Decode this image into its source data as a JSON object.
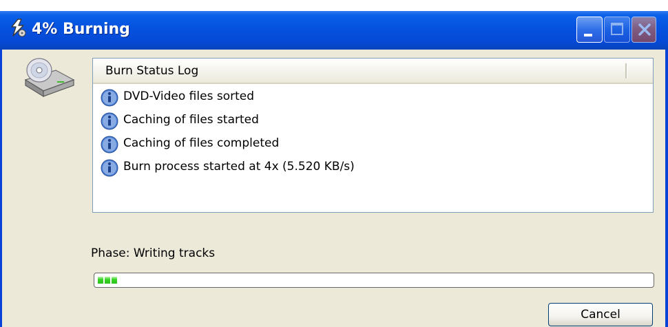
{
  "window": {
    "title": "4% Burning",
    "title_icon": "disc-burn-icon"
  },
  "log": {
    "header": "Burn Status Log",
    "entries": [
      {
        "icon": "info-icon",
        "text": "DVD-Video files sorted"
      },
      {
        "icon": "info-icon",
        "text": "Caching of files started"
      },
      {
        "icon": "info-icon",
        "text": "Caching of files completed"
      },
      {
        "icon": "info-icon",
        "text": "Burn process started at 4x (5.520 KB/s)"
      }
    ]
  },
  "phase": {
    "label": "Phase: Writing tracks"
  },
  "progress": {
    "percent": 4,
    "color": "#2cc11c"
  },
  "buttons": {
    "cancel": "Cancel"
  },
  "colors": {
    "titlebar": "#0652df",
    "client": "#ece9d8"
  }
}
